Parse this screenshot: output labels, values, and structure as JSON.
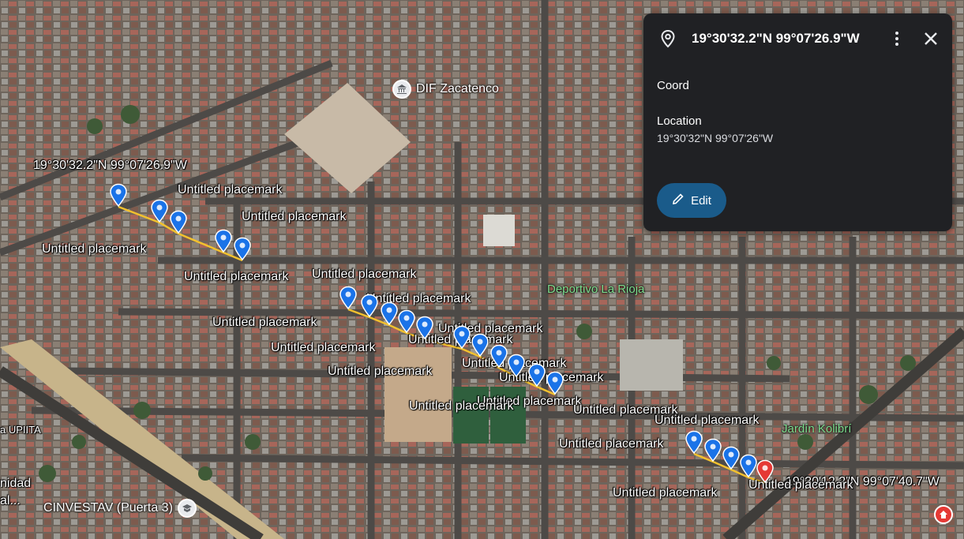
{
  "panel": {
    "title": "19°30'32.2\"N 99°07'26.9\"W",
    "coord_label": "Coord",
    "location_heading": "Location",
    "location_value": "19°30'32\"N 99°07'26\"W",
    "edit_label": "Edit",
    "more_icon": "more-vert-icon",
    "close_icon": "close-icon"
  },
  "map": {
    "coord_label_start": "19°30'32.2\"N 99°07'26.9\"W",
    "coord_label_end": "19°30'12.2\"N 99°07'40.7\"W",
    "poi_dif": "DIF Zacatenco",
    "poi_cinvestav": "CINVESTAV (Puerta 3)",
    "green_deportivo": "Deportivo La Rioja",
    "green_jardin": "Jardín Kolibrí",
    "edge_upiita": "a UPIITA",
    "edge_nidad": "nidad",
    "edge_al": "al...",
    "placemark_label": "Untitled placemark",
    "colors": {
      "pin_blue": "#1a73e8",
      "pin_red": "#e53935",
      "path": "#f2c12e",
      "panel_bg": "#202124",
      "edit_bg": "#1a5b8a"
    }
  }
}
